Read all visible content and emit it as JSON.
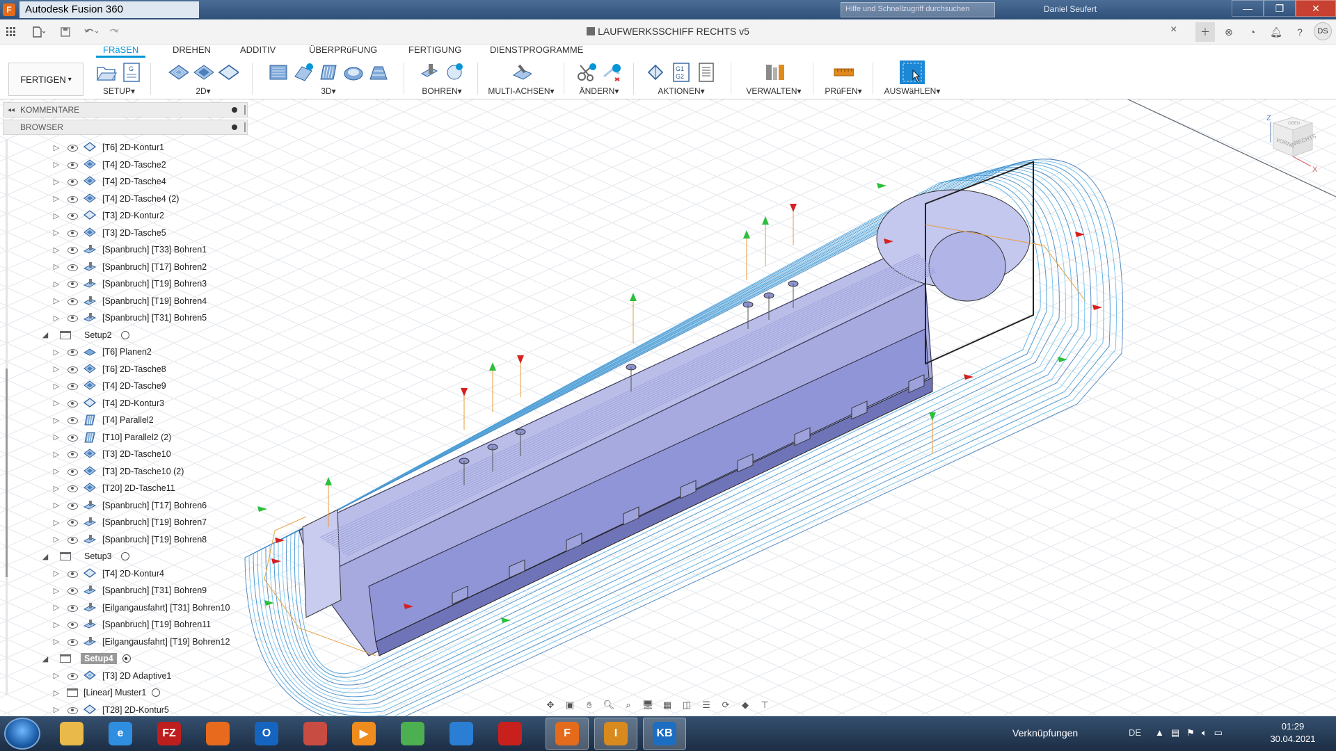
{
  "window": {
    "app_title": "Autodesk Fusion 360",
    "search_placeholder": "Hilfe und Schnellzugriff durchsuchen",
    "user_name": "Daniel Seufert",
    "buttons": {
      "minimize": "—",
      "maximize": "❐",
      "close": "✕"
    }
  },
  "appbar": {
    "document_title": "LAUFWERKSSCHIFF RECHTS v5",
    "tab_close": "×",
    "user_initials": "DS"
  },
  "ribbon": {
    "tabs": [
      "FRäSEN",
      "DREHEN",
      "ADDITIV",
      "ÜBERPRüFUNG",
      "FERTIGUNG",
      "DIENSTPROGRAMME"
    ],
    "active_tab": "FRäSEN",
    "workspace": "FERTIGEN",
    "groups": [
      "SETUP",
      "2D",
      "3D",
      "BOHREN",
      "MULTI-ACHSEN",
      "ÄNDERN",
      "AKTIONEN",
      "VERWALTEN",
      "PRüFEN",
      "AUSWäHLEN"
    ],
    "dropdown_caret": "▾"
  },
  "panels": {
    "comments": "KOMMENTARE",
    "browser": "BROWSER"
  },
  "tree": [
    {
      "kind": "op",
      "label": "[T6] 2D-Kontur1",
      "icon": "contour"
    },
    {
      "kind": "op",
      "label": "[T4] 2D-Tasche2",
      "icon": "pocket"
    },
    {
      "kind": "op",
      "label": "[T4] 2D-Tasche4",
      "icon": "pocket"
    },
    {
      "kind": "op",
      "label": "[T4] 2D-Tasche4 (2)",
      "icon": "pocket"
    },
    {
      "kind": "op",
      "label": "[T3] 2D-Kontur2",
      "icon": "contour"
    },
    {
      "kind": "op",
      "label": "[T3] 2D-Tasche5",
      "icon": "pocket"
    },
    {
      "kind": "op",
      "label": "[Spanbruch] [T33] Bohren1",
      "icon": "drill"
    },
    {
      "kind": "op",
      "label": "[Spanbruch] [T17] Bohren2",
      "icon": "drill"
    },
    {
      "kind": "op",
      "label": "[Spanbruch] [T19] Bohren3",
      "icon": "drill"
    },
    {
      "kind": "op",
      "label": "[Spanbruch] [T19] Bohren4",
      "icon": "drill"
    },
    {
      "kind": "op",
      "label": "[Spanbruch] [T31] Bohren5",
      "icon": "drill"
    },
    {
      "kind": "setup",
      "label": "Setup2",
      "active": false
    },
    {
      "kind": "op",
      "label": "[T6] Planen2",
      "icon": "face"
    },
    {
      "kind": "op",
      "label": "[T6] 2D-Tasche8",
      "icon": "pocket"
    },
    {
      "kind": "op",
      "label": "[T4] 2D-Tasche9",
      "icon": "pocket"
    },
    {
      "kind": "op",
      "label": "[T4] 2D-Kontur3",
      "icon": "contour"
    },
    {
      "kind": "op",
      "label": "[T4] Parallel2",
      "icon": "parallel"
    },
    {
      "kind": "op",
      "label": "[T10] Parallel2 (2)",
      "icon": "parallel"
    },
    {
      "kind": "op",
      "label": "[T3] 2D-Tasche10",
      "icon": "pocket"
    },
    {
      "kind": "op",
      "label": "[T3] 2D-Tasche10 (2)",
      "icon": "pocket"
    },
    {
      "kind": "op",
      "label": "[T20] 2D-Tasche11",
      "icon": "pocket"
    },
    {
      "kind": "op",
      "label": "[Spanbruch] [T17] Bohren6",
      "icon": "drill"
    },
    {
      "kind": "op",
      "label": "[Spanbruch] [T19] Bohren7",
      "icon": "drill"
    },
    {
      "kind": "op",
      "label": "[Spanbruch] [T19] Bohren8",
      "icon": "drill"
    },
    {
      "kind": "setup",
      "label": "Setup3",
      "active": false
    },
    {
      "kind": "op",
      "label": "[T4] 2D-Kontur4",
      "icon": "contour"
    },
    {
      "kind": "op",
      "label": "[Spanbruch] [T31] Bohren9",
      "icon": "drill"
    },
    {
      "kind": "op",
      "label": "[Eilgangausfahrt] [T31] Bohren10",
      "icon": "drill"
    },
    {
      "kind": "op",
      "label": "[Spanbruch] [T19] Bohren11",
      "icon": "drill"
    },
    {
      "kind": "op",
      "label": "[Eilgangausfahrt] [T19] Bohren12",
      "icon": "drill"
    },
    {
      "kind": "setup",
      "label": "Setup4",
      "active": true
    },
    {
      "kind": "op",
      "label": "[T3] 2D Adaptive1",
      "icon": "adaptive"
    },
    {
      "kind": "pattern",
      "label": "[Linear] Muster1"
    },
    {
      "kind": "op",
      "label": "[T28] 2D-Kontur5",
      "icon": "contour"
    }
  ],
  "viewcube": {
    "axis_z": "Z",
    "axis_x": "X",
    "face_front": "VORNE",
    "face_right": "RECHTS",
    "face_top": "OBEN"
  },
  "taskbar": {
    "links_label": "Verknüpfungen",
    "language": "DE",
    "time": "01:29",
    "date": "30.04.2021",
    "apps": [
      {
        "name": "explorer",
        "glyph": "",
        "color": "#e9b949"
      },
      {
        "name": "internet-explorer",
        "glyph": "e",
        "color": "#2f8ee0"
      },
      {
        "name": "filezilla",
        "glyph": "FZ",
        "color": "#bf1e1e"
      },
      {
        "name": "firefox",
        "glyph": "",
        "color": "#e86a1c"
      },
      {
        "name": "outlook",
        "glyph": "O",
        "color": "#1565c0"
      },
      {
        "name": "app-red",
        "glyph": "",
        "color": "#c94c43"
      },
      {
        "name": "media-player",
        "glyph": "▶",
        "color": "#f08c1d"
      },
      {
        "name": "chrome",
        "glyph": "",
        "color": "#4caf50"
      },
      {
        "name": "app-butterfly",
        "glyph": "",
        "color": "#2a7fd4"
      },
      {
        "name": "acrobat",
        "glyph": "",
        "color": "#c8201d"
      },
      {
        "name": "fusion360",
        "glyph": "F",
        "color": "#e46b1b"
      },
      {
        "name": "inventor",
        "glyph": "I",
        "color": "#d88a1e"
      },
      {
        "name": "kb",
        "glyph": "KB",
        "color": "#1c6ec2"
      }
    ]
  }
}
